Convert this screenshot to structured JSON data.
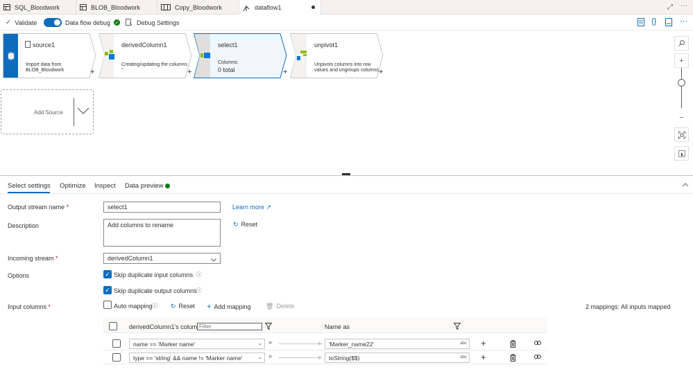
{
  "tabs": [
    {
      "label": "SQL_Bloodwork",
      "icon": "table-icon"
    },
    {
      "label": "BLOB_Bloodwork",
      "icon": "table-icon"
    },
    {
      "label": "Copy_Bloodwork",
      "icon": "pipeline-icon"
    },
    {
      "label": "dataflow1",
      "icon": "dataflow-icon",
      "unsaved": true
    }
  ],
  "toolbar": {
    "validate": "Validate",
    "debug": "Data flow debug",
    "debug_settings": "Debug Settings"
  },
  "nodes": {
    "source": {
      "title": "source1",
      "desc1": "Import data from",
      "desc2": "BLOB_Bloodwork"
    },
    "derived": {
      "title": "derivedColumn1",
      "desc1": "Creating/updating the columns",
      "desc2": "''"
    },
    "select": {
      "title": "select1",
      "desc1": "Columns:",
      "desc2": "0 total"
    },
    "unpivot": {
      "title": "unpivot1",
      "desc1": "Unpivots columns into row",
      "desc2": "values and ungroups columns"
    }
  },
  "add_source": "Add Source",
  "panel_tabs": [
    "Select settings",
    "Optimize",
    "Inspect",
    "Data preview"
  ],
  "form": {
    "output_stream_label": "Output stream name",
    "output_stream_value": "select1",
    "learn_more": "Learn more",
    "description_label": "Description",
    "description_value": "Add columns to rename",
    "reset": "Reset",
    "incoming_label": "Incoming stream",
    "incoming_value": "derivedColumn1",
    "options_label": "Options",
    "skip_input": "Skip duplicate input columns",
    "skip_output": "Skip duplicate output columns",
    "input_columns_label": "Input columns",
    "auto_mapping": "Auto mapping",
    "reset2": "Reset",
    "add_mapping": "Add mapping",
    "delete": "Delete",
    "mapping_status": "2 mappings: All inputs mapped",
    "col_header": "derivedColumn1's column",
    "filter_placeholder": "Filter",
    "name_as_header": "Name as"
  },
  "mappings": [
    {
      "input": "name == 'Marker name'",
      "output": "'Marker_name22'"
    },
    {
      "input": "type == 'string' && name != 'Marker name'",
      "output": "toString($$)"
    }
  ],
  "colors": {
    "accent": "#0f6cbd",
    "success": "#107c10",
    "node_selected": "#eff6fc"
  }
}
